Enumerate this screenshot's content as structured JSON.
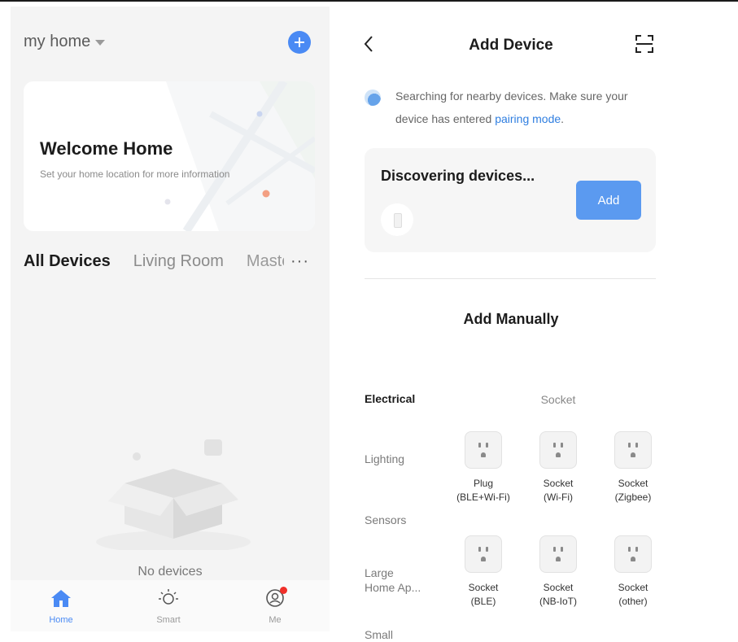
{
  "home": {
    "home_name": "my home",
    "welcome_title": "Welcome Home",
    "welcome_subtitle": "Set your home location for more information",
    "tabs": [
      {
        "label": "All Devices",
        "active": true
      },
      {
        "label": "Living Room",
        "active": false
      },
      {
        "label": "Master Bedroom",
        "active": false
      }
    ],
    "more_label": "···",
    "empty_text": "No devices",
    "nav": [
      {
        "label": "Home",
        "icon": "home-icon",
        "active": true
      },
      {
        "label": "Smart",
        "icon": "sun-icon",
        "active": false
      },
      {
        "label": "Me",
        "icon": "profile-icon",
        "active": false,
        "badge": true
      }
    ],
    "accent_color": "#4a8af4",
    "badge_color": "#f0302a"
  },
  "add_device": {
    "title": "Add Device",
    "search_text": "Searching for nearby devices. Make sure your device has entered ",
    "pairing_link": "pairing mode",
    "search_end": ".",
    "discovering_title": "Discovering devices...",
    "add_button": "Add",
    "manual_title": "Add Manually",
    "categories": [
      "Electrical",
      "Lighting",
      "Sensors",
      "Large\nHome Ap...",
      "Small"
    ],
    "active_category": "Electrical",
    "section_heading": "Socket",
    "devices": [
      {
        "label": "Plug\n(BLE+Wi-Fi)",
        "icon": "socket-icon"
      },
      {
        "label": "Socket\n(Wi-Fi)",
        "icon": "socket-icon"
      },
      {
        "label": "Socket\n(Zigbee)",
        "icon": "socket-icon"
      },
      {
        "label": "Socket\n(BLE)",
        "icon": "socket-icon"
      },
      {
        "label": "Socket\n(NB-IoT)",
        "icon": "socket-icon"
      },
      {
        "label": "Socket\n(other)",
        "icon": "socket-icon"
      }
    ],
    "link_color": "#2f7ee0",
    "button_color": "#5b9af0"
  }
}
